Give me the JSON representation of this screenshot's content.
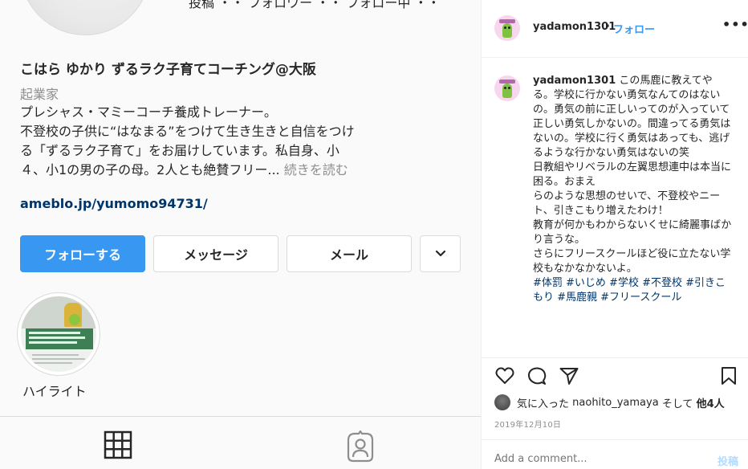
{
  "colors": {
    "accent": "#3897f0",
    "link": "#003569",
    "muted": "#8e8e8e",
    "text": "#262626"
  },
  "profile": {
    "stats_partial": "投稿 ・・ フォロワー ・・ フォロー中 ・・",
    "name": "こはら ゆかり ずるラク子育てコーチング@大阪",
    "category": "起業家",
    "bio_lines": [
      "プレシャス・マミーコーチ養成トレーナー。",
      "不登校の子供に“はなまる”をつけて生き生きと自信をつけ",
      "る「ずるラク子育て」をお届けしています。私自身、小",
      "４、小1の男の子の母。2人とも絶賛フリー..."
    ],
    "bio_more": "続きを読む",
    "link": "ameblo.jp/yumomo94731/",
    "buttons": {
      "follow": "フォローする",
      "message": "メッセージ",
      "mail": "メール",
      "more_icon": "chevron-down-icon"
    },
    "highlight_label": "ハイライト",
    "tabs": [
      "grid-icon",
      "tagged-icon"
    ]
  },
  "post": {
    "header": {
      "username": "yadamon1301",
      "separator": "•",
      "follow": "フォロー",
      "more": "•••"
    },
    "caption": {
      "username": "yadamon1301",
      "lines": [
        "この馬鹿に教えてやる。学校に行かない勇気なんてのはないの。勇気の前に正しいってのが入っていて正しい勇気しかないの。間違ってる勇気はないの。学校に行く勇気はあっても、逃げるような行かない勇気はないの笑",
        "日教組やリベラルの左翼思想連中は本当に困る。おまえ",
        "らのような思想のせいで、不登校やニート、引きこもり増えたわけ！",
        "教育が何かもわからないくせに綺麗事ばかり言うな。",
        "さらにフリースクールほど役に立たない学校もなかなかないよ。"
      ],
      "hashtags": "#体罰 #いじめ #学校 #不登校 #引きこもり #馬鹿親 #フリースクール"
    },
    "actions": [
      "heart-icon",
      "comment-icon",
      "share-icon",
      "bookmark-icon"
    ],
    "likes": {
      "prefix": "気に入った",
      "user": "naohito_yamaya",
      "middle": "そして",
      "others": "他4人"
    },
    "date": "2019年12月10日",
    "comment_placeholder": "Add a comment...",
    "post_button": "投稿"
  }
}
